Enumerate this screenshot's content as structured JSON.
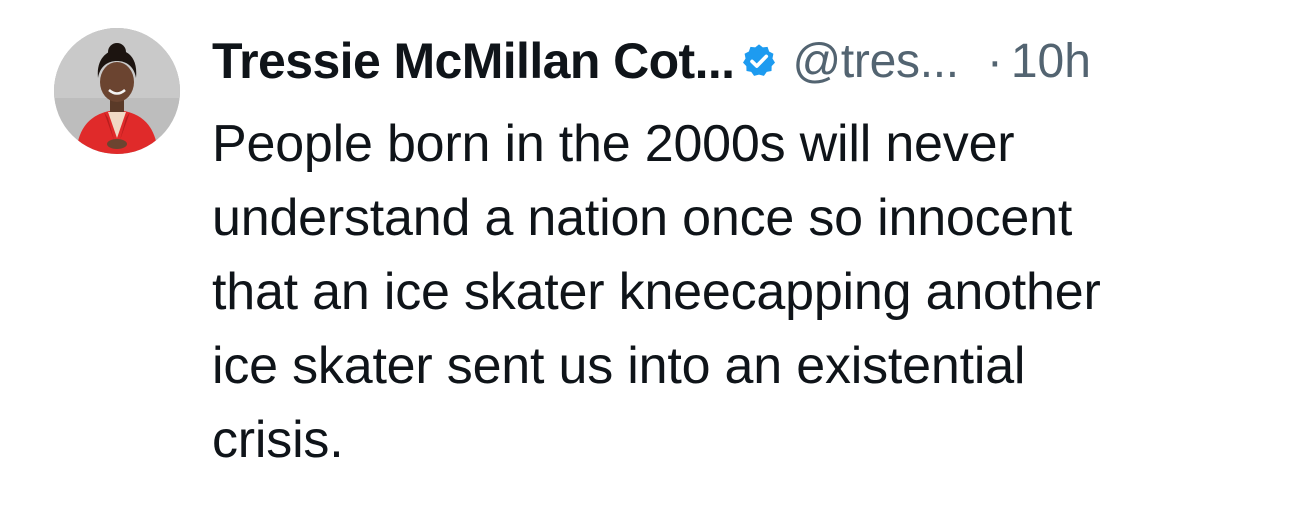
{
  "post": {
    "author": {
      "display_name": "Tressie McMillan Cot...",
      "handle": "@tres...",
      "verified": true,
      "avatar_icon": "profile-photo",
      "verified_icon": "verified-check-icon",
      "verified_color": "#1d9bf0"
    },
    "separator": "·",
    "timestamp": "10h",
    "text_lines": [
      "People born in the 2000s will never",
      "understand a nation once so innocent",
      "that an ice skater kneecapping another",
      "ice skater sent us into an existential",
      "crisis."
    ]
  }
}
